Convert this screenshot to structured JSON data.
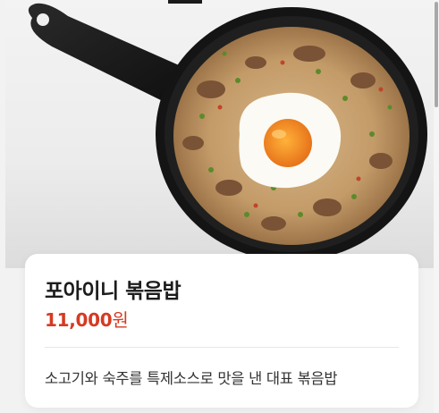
{
  "menu_item": {
    "name": "포아이니 볶음밥",
    "price_number": "11,000",
    "price_unit": "원",
    "description": "소고기와 숙주를 특제소스로 맛을 낸 대표 볶음밥"
  },
  "colors": {
    "price": "#d63a22",
    "pan": "#141414",
    "rice": "#c8a070",
    "egg_yolk": "#f08a1c"
  },
  "icons": {
    "photo": "fried-rice-pan-photo"
  }
}
